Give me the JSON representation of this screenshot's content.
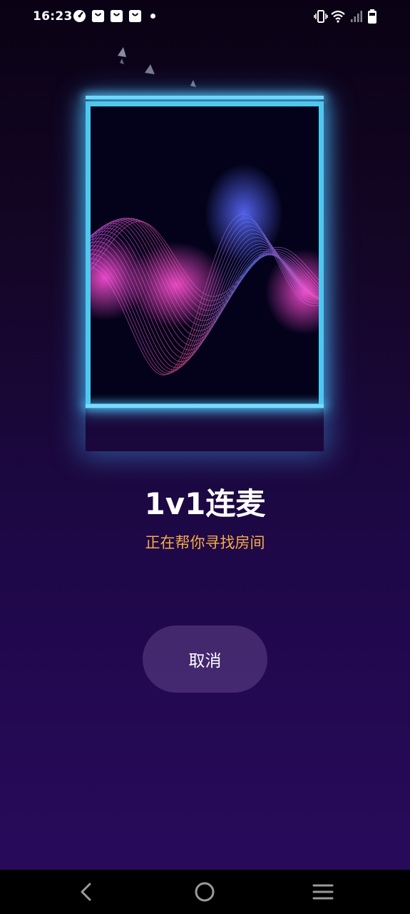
{
  "status_bar": {
    "time": "16:23",
    "left_icons": [
      "speedometer-icon",
      "shopping-bag-icon",
      "shopping-bag-icon",
      "shopping-bag-icon",
      "dot-icon"
    ],
    "right_icons": [
      "vibrate-icon",
      "wifi-icon",
      "signal-icon",
      "battery-icon"
    ]
  },
  "main": {
    "title": "1v1连麦",
    "subtitle": "正在帮你寻找房间",
    "cancel_label": "取消"
  },
  "nav_bar": {
    "icons": [
      "back-icon",
      "home-icon",
      "menu-icon"
    ]
  },
  "colors": {
    "background_top": "#0a0214",
    "background_bottom": "#2a0a5e",
    "frame": "#4fc8f0",
    "subtitle": "#f4ad45",
    "button_bg": "#4b3470"
  }
}
